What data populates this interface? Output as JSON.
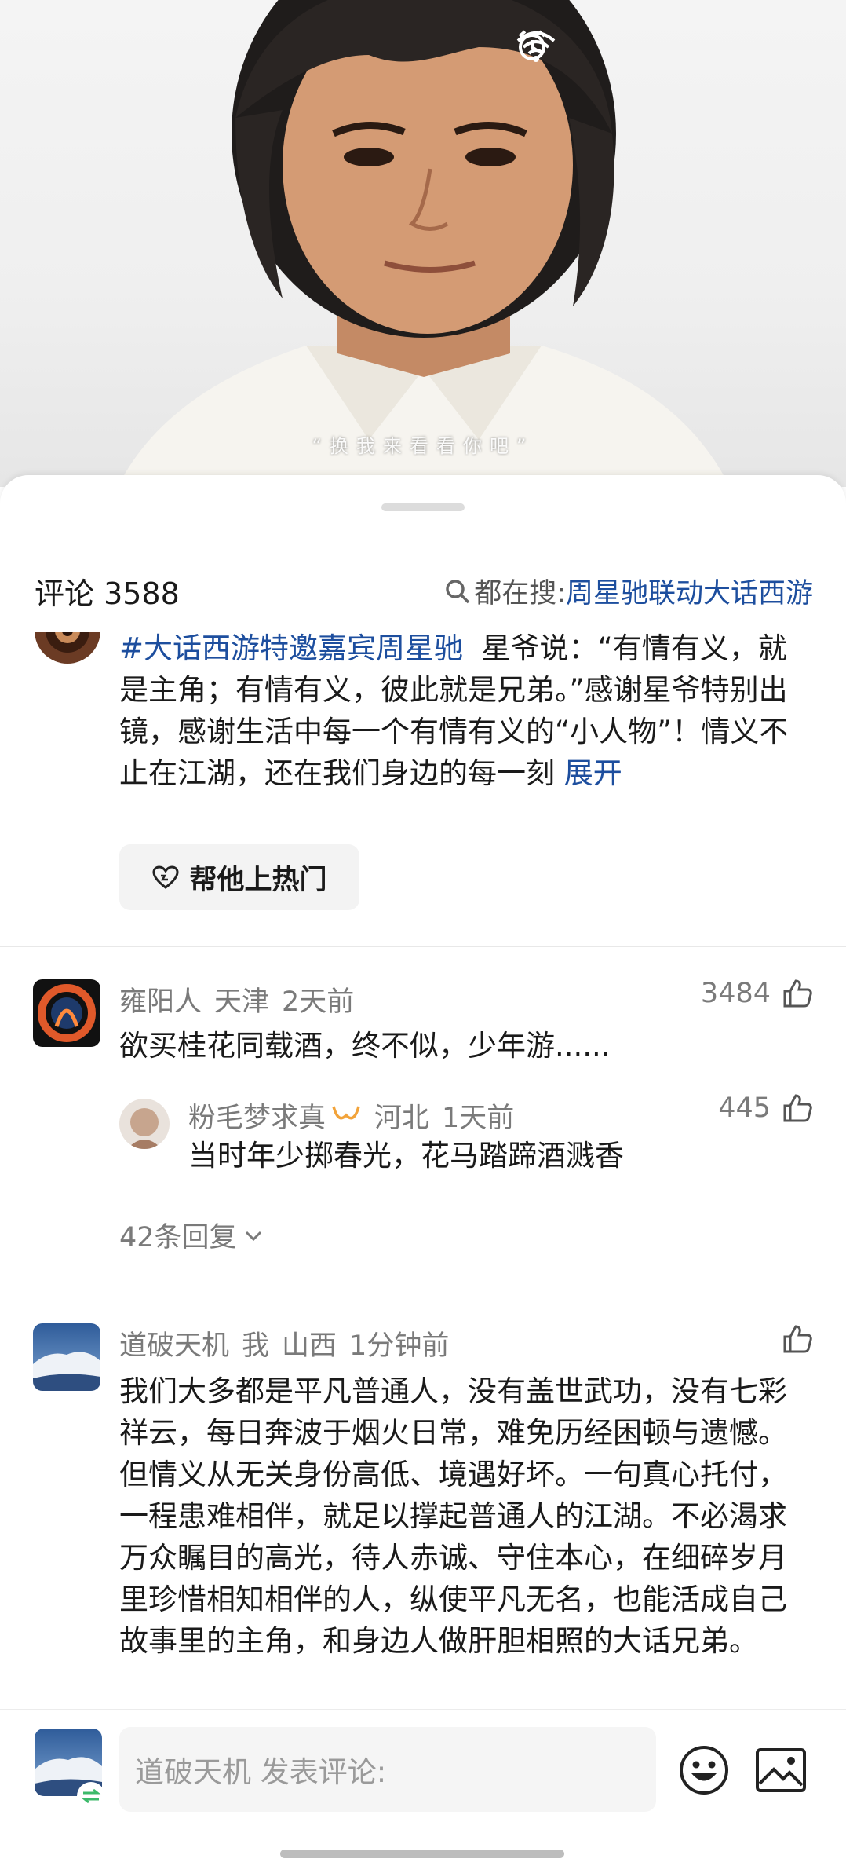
{
  "video": {
    "subtitle": "“换我来看看你吧”"
  },
  "status_bar": {
    "icons": [
      "alarm-icon",
      "wifi-icon"
    ]
  },
  "comments_header": {
    "title": "评论 3588",
    "search_label": "都在搜:",
    "search_keyword": "周星驰联动大话西游"
  },
  "pinned": {
    "hashtag": "#大话西游特邀嘉宾周星驰",
    "text": "星爷说：“有情有义，就是主角；有情有义，彼此就是兄弟。”感谢星爷特别出镜，感谢生活中每一个有情有义的“小人物”！情义不止在江湖，还在我们身边的每一刻",
    "expand_label": "展开",
    "boost_label": "帮他上热门"
  },
  "comments": [
    {
      "user": "雍阳人",
      "location": "天津",
      "time": "2天前",
      "likes": "3484",
      "text": "欲买桂花同载酒，终不似，少年游......",
      "reply": {
        "user": "粉毛梦求真",
        "location": "河北",
        "time": "1天前",
        "likes": "445",
        "text": "当时年少掷春光，花马踏蹄酒溅香"
      },
      "reply_count": "42条回复"
    },
    {
      "user": "道破天机",
      "tag": "我",
      "location": "山西",
      "time": "1分钟前",
      "likes": "",
      "text": "我们大多都是平凡普通人，没有盖世武功，没有七彩祥云，每日奔波于烟火日常，难免历经困顿与遗憾。但情义从无关身份高低、境遇好坏。一句真心托付，一程患难相伴，就足以撑起普通人的江湖。不必渴求万众瞩目的高光，待人赤诚、守住本心，在细碎岁月里珍惜相知相伴的人，纵使平凡无名，也能活成自己故事里的主角，和身边人做肝胆相照的大话兄弟。"
    }
  ],
  "input_bar": {
    "placeholder": "道破天机 发表评论:"
  },
  "colors": {
    "link": "#1d4e9e",
    "meta": "#7a7a7a",
    "button_bg": "#f3f3f3"
  }
}
